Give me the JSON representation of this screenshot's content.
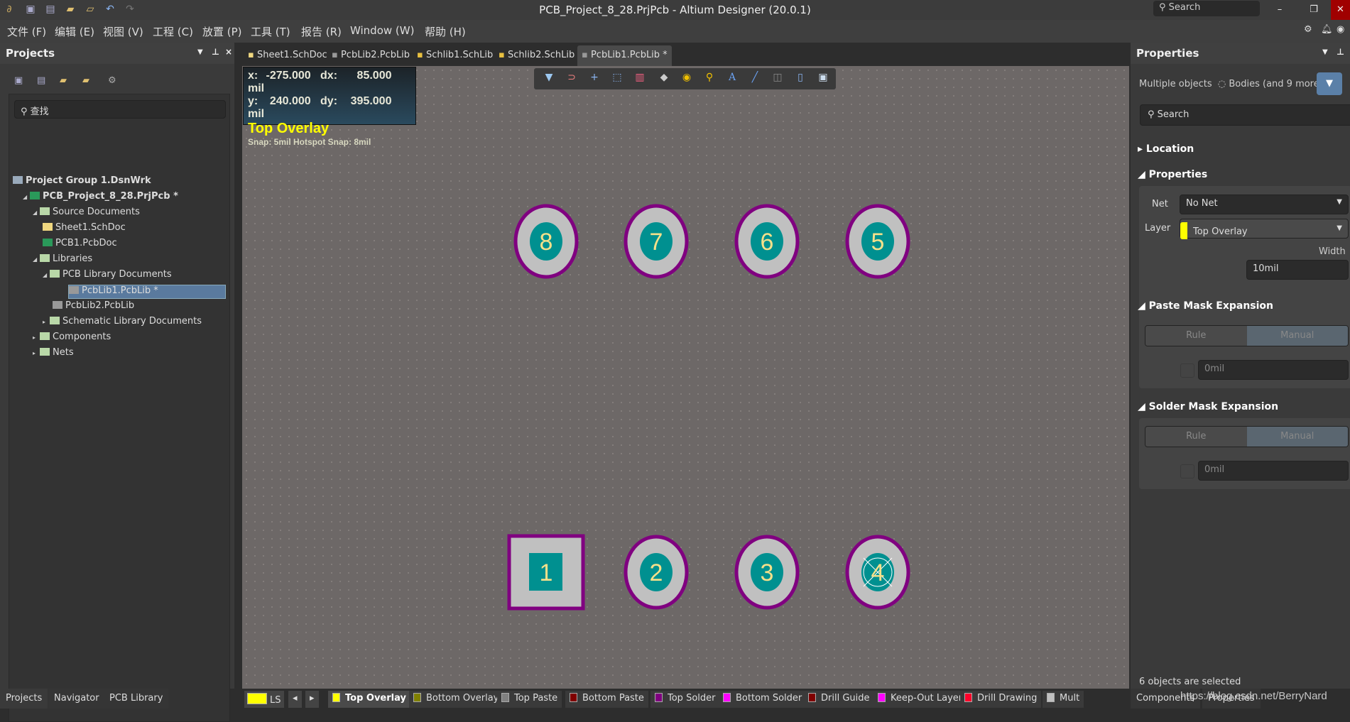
{
  "window": {
    "title": "PCB_Project_8_28.PrjPcb - Altium Designer (20.0.1)",
    "search_placeholder": "Search"
  },
  "menu": [
    "文件 (F)",
    "编辑 (E)",
    "视图 (V)",
    "工程 (C)",
    "放置 (P)",
    "工具 (T)",
    "报告 (R)",
    "Window (W)",
    "帮助 (H)"
  ],
  "projects": {
    "title": "Projects",
    "search_placeholder": "查找",
    "tree": [
      {
        "label": "Project Group 1.DsnWrk",
        "level": 0,
        "bold": true
      },
      {
        "label": "PCB_Project_8_28.PrjPcb *",
        "level": 1,
        "bold": true
      },
      {
        "label": "Source Documents",
        "level": 2
      },
      {
        "label": "Sheet1.SchDoc",
        "level": 3
      },
      {
        "label": "PCB1.PcbDoc",
        "level": 3
      },
      {
        "label": "Libraries",
        "level": 2
      },
      {
        "label": "PCB Library Documents",
        "level": 3
      },
      {
        "label": "PcbLib1.PcbLib *",
        "level": 4,
        "selected": true
      },
      {
        "label": "PcbLib2.PcbLib",
        "level": 4
      },
      {
        "label": "Schematic Library Documents",
        "level": 3
      },
      {
        "label": "Components",
        "level": 2
      },
      {
        "label": "Nets",
        "level": 2
      }
    ],
    "bottom_tabs": [
      "Projects",
      "Navigator",
      "PCB Library"
    ]
  },
  "tabs": [
    {
      "label": "Sheet1.SchDoc"
    },
    {
      "label": "PcbLib2.PcbLib"
    },
    {
      "label": "Schlib1.SchLib"
    },
    {
      "label": "Schlib2.SchLib"
    },
    {
      "label": "PcbLib1.PcbLib *",
      "active": true
    }
  ],
  "hud": {
    "x_label": "x:",
    "x": "-275.000",
    "dx_label": "dx:",
    "dx": "85.000",
    "unit1": "mil",
    "y_label": "y:",
    "y": "240.000",
    "dy_label": "dy:",
    "dy": "395.000",
    "unit2": "mil",
    "layer": "Top Overlay",
    "snap": "Snap: 5mil Hotspot Snap: 8mil"
  },
  "pads": [
    {
      "num": "8",
      "shape": "round"
    },
    {
      "num": "7",
      "shape": "round"
    },
    {
      "num": "6",
      "shape": "round"
    },
    {
      "num": "5",
      "shape": "round"
    },
    {
      "num": "1",
      "shape": "square"
    },
    {
      "num": "2",
      "shape": "round"
    },
    {
      "num": "3",
      "shape": "round"
    },
    {
      "num": "4",
      "shape": "round",
      "marked": true
    }
  ],
  "colors": {
    "pad_copper": "#009090",
    "pad_ring": "#c0c0c0",
    "solder_mask": "#800080",
    "pad_text": "#f5e08a",
    "top_overlay": "#ffff00"
  },
  "properties": {
    "title": "Properties",
    "selection": "Multiple objects",
    "filter_text": "Bodies (and 9 more)",
    "search_placeholder": "Search",
    "location": "Location",
    "properties_section": "Properties",
    "net_label": "Net",
    "net_value": "No Net",
    "layer_label": "Layer",
    "layer_value": "Top Overlay",
    "width_label": "Width",
    "width_value": "10mil",
    "paste": {
      "title": "Paste Mask Expansion",
      "rule": "Rule",
      "manual": "Manual",
      "value": "0mil"
    },
    "solder": {
      "title": "Solder Mask Expansion",
      "rule": "Rule",
      "manual": "Manual",
      "value": "0mil"
    },
    "status": "6 objects are selected",
    "bottom_tabs": [
      "Components",
      "Properties"
    ],
    "watermark": "https://blog.csdn.net/BerryNard"
  },
  "statusbar": {
    "ls": "LS",
    "layers": [
      {
        "name": "Top Overlay",
        "color": "#ffff00",
        "active": true
      },
      {
        "name": "Bottom Overlay",
        "color": "#808000"
      },
      {
        "name": "Top Paste",
        "color": "#808080"
      },
      {
        "name": "Bottom Paste",
        "color": "#800000"
      },
      {
        "name": "Top Solder",
        "color": "#800080"
      },
      {
        "name": "Bottom Solder",
        "color": "#ff00ff"
      },
      {
        "name": "Drill Guide",
        "color": "#800000"
      },
      {
        "name": "Keep-Out Layer",
        "color": "#ff00ff"
      },
      {
        "name": "Drill Drawing",
        "color": "#ff002a"
      },
      {
        "name": "Mult",
        "color": "#c0c0c0"
      }
    ]
  }
}
